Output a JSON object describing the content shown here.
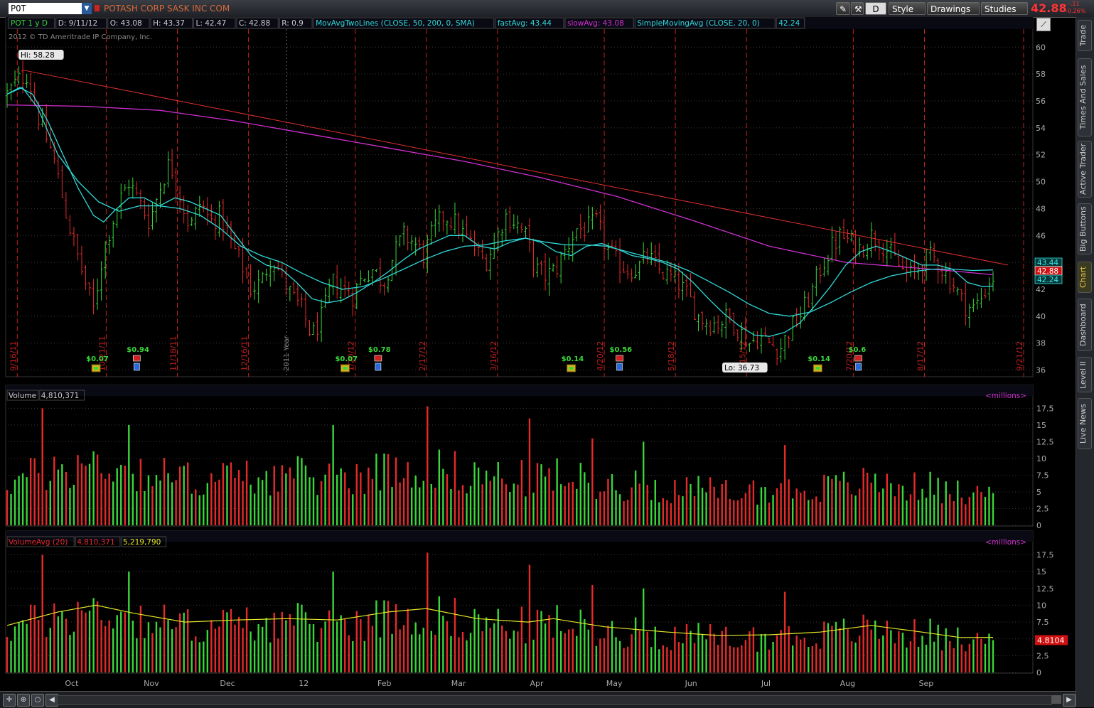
{
  "symbol": "POT",
  "company_name": "POTASH CORP SASK INC COM",
  "toolbar": {
    "period": "D",
    "style": "Style",
    "drawings": "Drawings",
    "studies": "Studies"
  },
  "header_price": "42.88",
  "header_change": "-.11",
  "header_change_pct": "-0.26%",
  "info_bar": [
    "POT 1 y D",
    "D: 9/11/12",
    "O: 43.08",
    "H: 43.37",
    "L: 42.47",
    "C: 42.88",
    "R: 0.9",
    "MovAvgTwoLines (CLOSE, 50, 200, 0, SMA)",
    "fastAvg: 43.44",
    "slowAvg: 43.08",
    "SimpleMovingAvg (CLOSE, 20, 0)",
    "42.24"
  ],
  "copyright": "2012 © TD Ameritrade IP Company, Inc.",
  "sidebar_tabs": [
    "Trade",
    "Times And Sales",
    "Active Trader",
    "Big Buttons",
    "Chart",
    "Dashboard",
    "Level II",
    "Live News"
  ],
  "volume_panel": {
    "title": "Volume",
    "value": "4,810,371",
    "units": "<millions>"
  },
  "volavg_panel": {
    "title": "VolumeAvg (20)",
    "value1": "4,810,371",
    "value2": "5,219,790",
    "units": "<millions>",
    "last_tag": "4.8104"
  },
  "colors": {
    "up": "#3ad63a",
    "down": "#e52a2a",
    "fast_avg": "#30d8d8",
    "slow_avg": "#d030d0",
    "sma20": "#30d8d8",
    "trendline": "#e03030",
    "vol_avg": "#e6e62a",
    "grid": "#3a3a3a"
  },
  "chart_data": [
    {
      "type": "candlestick",
      "title": "POT 1 y D",
      "x_start": "2011-09-12",
      "x_end": "2012-09-11",
      "ylim": [
        35.5,
        60.7
      ],
      "y_ticks": [
        36,
        38,
        40,
        42,
        44,
        46,
        48,
        50,
        52,
        54,
        56,
        58,
        60
      ],
      "x_tick_labels": [
        "Oct",
        "Nov",
        "Dec",
        "12",
        "Feb",
        "Mar",
        "Apr",
        "May",
        "Jun",
        "Jul",
        "Aug",
        "Sep"
      ],
      "expiration_labels": [
        "9/16/11",
        "10/21/11",
        "11/18/11",
        "12/16/11",
        "1/20/12",
        "2/17/12",
        "3/16/12",
        "4/20/12",
        "5/18/12",
        "6/15/12",
        "7/20/12",
        "8/17/12",
        "9/21/12"
      ],
      "year_label": "2011 Year",
      "high_label": "Hi: 58.28",
      "low_label": "Lo: 36.73",
      "dividends": [
        "$0.07",
        "$0.07",
        "$0.14",
        "$0.14"
      ],
      "earnings": [
        "$0.94",
        "$0.78",
        "$0.56",
        "$0.6"
      ],
      "trendline": {
        "from_price": 58.3,
        "to_price": 43.8
      },
      "last_tags": {
        "fast_avg": "43.44",
        "last": "42.88",
        "sma20": "42.24"
      },
      "close_path": [
        [
          0,
          56.5
        ],
        [
          4,
          57.5
        ],
        [
          8,
          58.0
        ],
        [
          12,
          55.0
        ],
        [
          18,
          52.0
        ],
        [
          24,
          47.0
        ],
        [
          30,
          43.0
        ],
        [
          34,
          40.5
        ],
        [
          38,
          45.0
        ],
        [
          44,
          48.5
        ],
        [
          48,
          50.0
        ],
        [
          52,
          48.5
        ],
        [
          56,
          47.0
        ],
        [
          60,
          49.5
        ],
        [
          64,
          51.5
        ],
        [
          68,
          49.0
        ],
        [
          72,
          46.5
        ],
        [
          76,
          48.5
        ],
        [
          80,
          47.0
        ],
        [
          84,
          47.5
        ],
        [
          88,
          45.5
        ],
        [
          92,
          44.0
        ],
        [
          96,
          42.0
        ],
        [
          100,
          42.5
        ],
        [
          104,
          44.5
        ],
        [
          108,
          43.0
        ],
        [
          112,
          41.5
        ],
        [
          116,
          40.5
        ],
        [
          120,
          38.5
        ],
        [
          124,
          40.0
        ],
        [
          128,
          42.5
        ],
        [
          132,
          42.0
        ],
        [
          136,
          41.5
        ],
        [
          140,
          43.0
        ],
        [
          144,
          43.5
        ],
        [
          148,
          42.5
        ],
        [
          152,
          44.5
        ],
        [
          156,
          46.0
        ],
        [
          160,
          45.5
        ],
        [
          164,
          44.5
        ],
        [
          168,
          46.5
        ],
        [
          172,
          47.5
        ],
        [
          176,
          47.0
        ],
        [
          180,
          46.0
        ],
        [
          184,
          45.0
        ],
        [
          188,
          44.0
        ],
        [
          192,
          45.5
        ],
        [
          196,
          47.5
        ],
        [
          200,
          47.0
        ],
        [
          204,
          46.0
        ],
        [
          208,
          43.5
        ],
        [
          212,
          43.0
        ],
        [
          216,
          43.5
        ],
        [
          220,
          45.0
        ],
        [
          224,
          46.5
        ],
        [
          228,
          46.5
        ],
        [
          232,
          47.0
        ],
        [
          236,
          45.0
        ],
        [
          240,
          44.0
        ],
        [
          244,
          43.5
        ],
        [
          248,
          43.5
        ],
        [
          252,
          44.5
        ],
        [
          256,
          43.5
        ],
        [
          260,
          43.0
        ],
        [
          264,
          42.5
        ],
        [
          268,
          41.5
        ],
        [
          272,
          40.0
        ],
        [
          276,
          39.5
        ],
        [
          280,
          39.5
        ],
        [
          284,
          40.0
        ],
        [
          288,
          39.0
        ],
        [
          292,
          38.0
        ],
        [
          296,
          38.5
        ],
        [
          300,
          38.0
        ],
        [
          304,
          37.5
        ],
        [
          308,
          39.0
        ],
        [
          312,
          40.0
        ],
        [
          316,
          41.5
        ],
        [
          320,
          43.5
        ],
        [
          324,
          45.0
        ],
        [
          328,
          46.0
        ],
        [
          332,
          45.5
        ],
        [
          336,
          45.0
        ],
        [
          340,
          46.0
        ],
        [
          344,
          45.5
        ],
        [
          348,
          44.5
        ],
        [
          352,
          43.5
        ],
        [
          356,
          43.0
        ],
        [
          360,
          44.0
        ],
        [
          364,
          44.5
        ],
        [
          368,
          43.5
        ],
        [
          372,
          42.5
        ],
        [
          376,
          41.0
        ],
        [
          380,
          40.5
        ],
        [
          384,
          41.5
        ],
        [
          386,
          42.5
        ],
        [
          388,
          42.88
        ]
      ],
      "fast_avg_path": [
        [
          0,
          56.5
        ],
        [
          6,
          57.0
        ],
        [
          12,
          55.5
        ],
        [
          20,
          52.0
        ],
        [
          28,
          50.0
        ],
        [
          36,
          48.5
        ],
        [
          44,
          47.8
        ],
        [
          52,
          48.2
        ],
        [
          60,
          48.2
        ],
        [
          68,
          48.0
        ],
        [
          76,
          47.5
        ],
        [
          84,
          46.5
        ],
        [
          92,
          45.2
        ],
        [
          100,
          44.5
        ],
        [
          108,
          44.0
        ],
        [
          116,
          43.2
        ],
        [
          124,
          42.5
        ],
        [
          132,
          42.0
        ],
        [
          140,
          42.2
        ],
        [
          148,
          42.8
        ],
        [
          156,
          43.5
        ],
        [
          164,
          44.2
        ],
        [
          172,
          44.8
        ],
        [
          180,
          45.2
        ],
        [
          188,
          45.3
        ],
        [
          196,
          45.6
        ],
        [
          204,
          45.8
        ],
        [
          212,
          45.5
        ],
        [
          220,
          45.3
        ],
        [
          228,
          45.3
        ],
        [
          236,
          45.2
        ],
        [
          244,
          44.8
        ],
        [
          252,
          44.4
        ],
        [
          260,
          44.0
        ],
        [
          268,
          43.4
        ],
        [
          276,
          42.6
        ],
        [
          284,
          41.8
        ],
        [
          292,
          40.9
        ],
        [
          300,
          40.2
        ],
        [
          308,
          40.0
        ],
        [
          316,
          40.3
        ],
        [
          324,
          41.0
        ],
        [
          332,
          41.8
        ],
        [
          340,
          42.5
        ],
        [
          348,
          43.0
        ],
        [
          356,
          43.3
        ],
        [
          364,
          43.5
        ],
        [
          372,
          43.5
        ],
        [
          380,
          43.4
        ],
        [
          388,
          43.44
        ]
      ],
      "slow_avg_path": [
        [
          0,
          55.7
        ],
        [
          30,
          55.6
        ],
        [
          60,
          55.3
        ],
        [
          90,
          54.5
        ],
        [
          120,
          53.5
        ],
        [
          150,
          52.5
        ],
        [
          180,
          51.5
        ],
        [
          210,
          50.3
        ],
        [
          240,
          48.9
        ],
        [
          270,
          47.1
        ],
        [
          300,
          45.2
        ],
        [
          315,
          44.6
        ],
        [
          330,
          44.0
        ],
        [
          350,
          43.7
        ],
        [
          370,
          43.4
        ],
        [
          388,
          43.08
        ]
      ],
      "sma20_path": [
        [
          0,
          56.5
        ],
        [
          5,
          57.0
        ],
        [
          10,
          56.5
        ],
        [
          16,
          54.5
        ],
        [
          22,
          52.0
        ],
        [
          28,
          49.5
        ],
        [
          34,
          47.5
        ],
        [
          38,
          47.0
        ],
        [
          42,
          47.8
        ],
        [
          48,
          48.8
        ],
        [
          54,
          48.8
        ],
        [
          60,
          48.2
        ],
        [
          66,
          48.8
        ],
        [
          72,
          48.5
        ],
        [
          78,
          48.0
        ],
        [
          84,
          47.5
        ],
        [
          90,
          46.0
        ],
        [
          96,
          44.5
        ],
        [
          102,
          43.8
        ],
        [
          108,
          43.5
        ],
        [
          114,
          42.5
        ],
        [
          120,
          41.3
        ],
        [
          126,
          41.0
        ],
        [
          132,
          41.2
        ],
        [
          138,
          41.8
        ],
        [
          144,
          42.5
        ],
        [
          150,
          43.3
        ],
        [
          156,
          44.2
        ],
        [
          162,
          45.0
        ],
        [
          168,
          45.5
        ],
        [
          174,
          46.0
        ],
        [
          180,
          46.0
        ],
        [
          186,
          45.2
        ],
        [
          192,
          45.0
        ],
        [
          198,
          45.5
        ],
        [
          204,
          45.8
        ],
        [
          210,
          45.5
        ],
        [
          216,
          44.8
        ],
        [
          222,
          44.5
        ],
        [
          228,
          45.2
        ],
        [
          234,
          45.4
        ],
        [
          240,
          45.0
        ],
        [
          246,
          44.5
        ],
        [
          252,
          44.3
        ],
        [
          258,
          44.0
        ],
        [
          264,
          43.5
        ],
        [
          270,
          42.5
        ],
        [
          276,
          41.3
        ],
        [
          282,
          40.2
        ],
        [
          288,
          39.3
        ],
        [
          294,
          38.6
        ],
        [
          300,
          38.5
        ],
        [
          306,
          38.8
        ],
        [
          312,
          39.5
        ],
        [
          318,
          40.8
        ],
        [
          324,
          42.2
        ],
        [
          330,
          43.8
        ],
        [
          336,
          44.8
        ],
        [
          342,
          45.2
        ],
        [
          348,
          44.8
        ],
        [
          354,
          44.3
        ],
        [
          360,
          43.8
        ],
        [
          366,
          43.8
        ],
        [
          372,
          43.5
        ],
        [
          378,
          42.5
        ],
        [
          384,
          42.2
        ],
        [
          388,
          42.24
        ]
      ]
    },
    {
      "type": "bar",
      "title": "Volume",
      "units": "millions",
      "ylim": [
        0,
        18.5
      ],
      "y_ticks": [
        0,
        2.5,
        5,
        7.5,
        10,
        12.5,
        15,
        17.5
      ],
      "spikes": [
        [
          14,
          17.5
        ],
        [
          48,
          15.0
        ],
        [
          128,
          15.0
        ],
        [
          152,
          17.0
        ],
        [
          165,
          17.8
        ],
        [
          202,
          15.5
        ],
        [
          206,
          16.0
        ],
        [
          230,
          13.0
        ],
        [
          250,
          12.5
        ],
        [
          306,
          12.0
        ],
        [
          338,
          12.5
        ],
        [
          363,
          8.0
        ],
        [
          381,
          7.0
        ],
        [
          388,
          4.81
        ]
      ],
      "last_value": 4.81
    },
    {
      "type": "bar+line",
      "title": "VolumeAvg (20)",
      "units": "millions",
      "ylim": [
        0,
        18.5
      ],
      "y_ticks": [
        0,
        2.5,
        5,
        7.5,
        10,
        12.5,
        15,
        17.5
      ],
      "avg_path": [
        [
          0,
          7.0
        ],
        [
          20,
          9.0
        ],
        [
          35,
          10.0
        ],
        [
          50,
          8.8
        ],
        [
          70,
          7.5
        ],
        [
          90,
          7.8
        ],
        [
          110,
          8.0
        ],
        [
          130,
          7.8
        ],
        [
          150,
          9.0
        ],
        [
          165,
          9.5
        ],
        [
          185,
          8.0
        ],
        [
          205,
          7.5
        ],
        [
          215,
          8.0
        ],
        [
          235,
          6.8
        ],
        [
          260,
          6.0
        ],
        [
          280,
          5.5
        ],
        [
          300,
          5.6
        ],
        [
          320,
          6.0
        ],
        [
          340,
          7.0
        ],
        [
          360,
          6.0
        ],
        [
          375,
          5.2
        ],
        [
          388,
          5.22
        ]
      ],
      "last_value": 4.8104
    }
  ]
}
